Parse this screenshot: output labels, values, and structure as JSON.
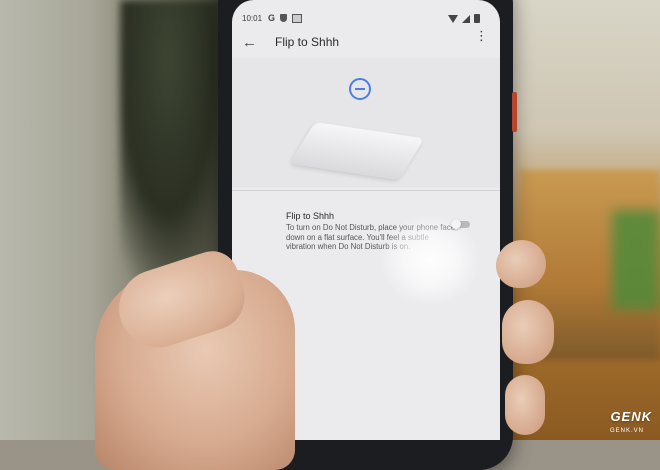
{
  "status_bar": {
    "time": "10:01",
    "icons_left": [
      "google-g-icon",
      "shield-icon",
      "image-icon"
    ],
    "icons_right": [
      "wifi-icon",
      "signal-icon",
      "battery-icon"
    ],
    "g_glyph": "G"
  },
  "app_bar": {
    "title": "Flip to Shhh",
    "back_glyph": "←",
    "overflow_glyph": "⋮"
  },
  "setting": {
    "title": "Flip to Shhh",
    "description": "To turn on Do Not Disturb, place your phone face down on a flat surface. You'll feel a subtle vibration when Do Not Disturb is on.",
    "toggle_on": false
  },
  "watermark": {
    "brand": "GENK",
    "url": "GENK.VN"
  },
  "colors": {
    "accent": "#4a7fe6",
    "screen_bg": "#ebebee"
  }
}
